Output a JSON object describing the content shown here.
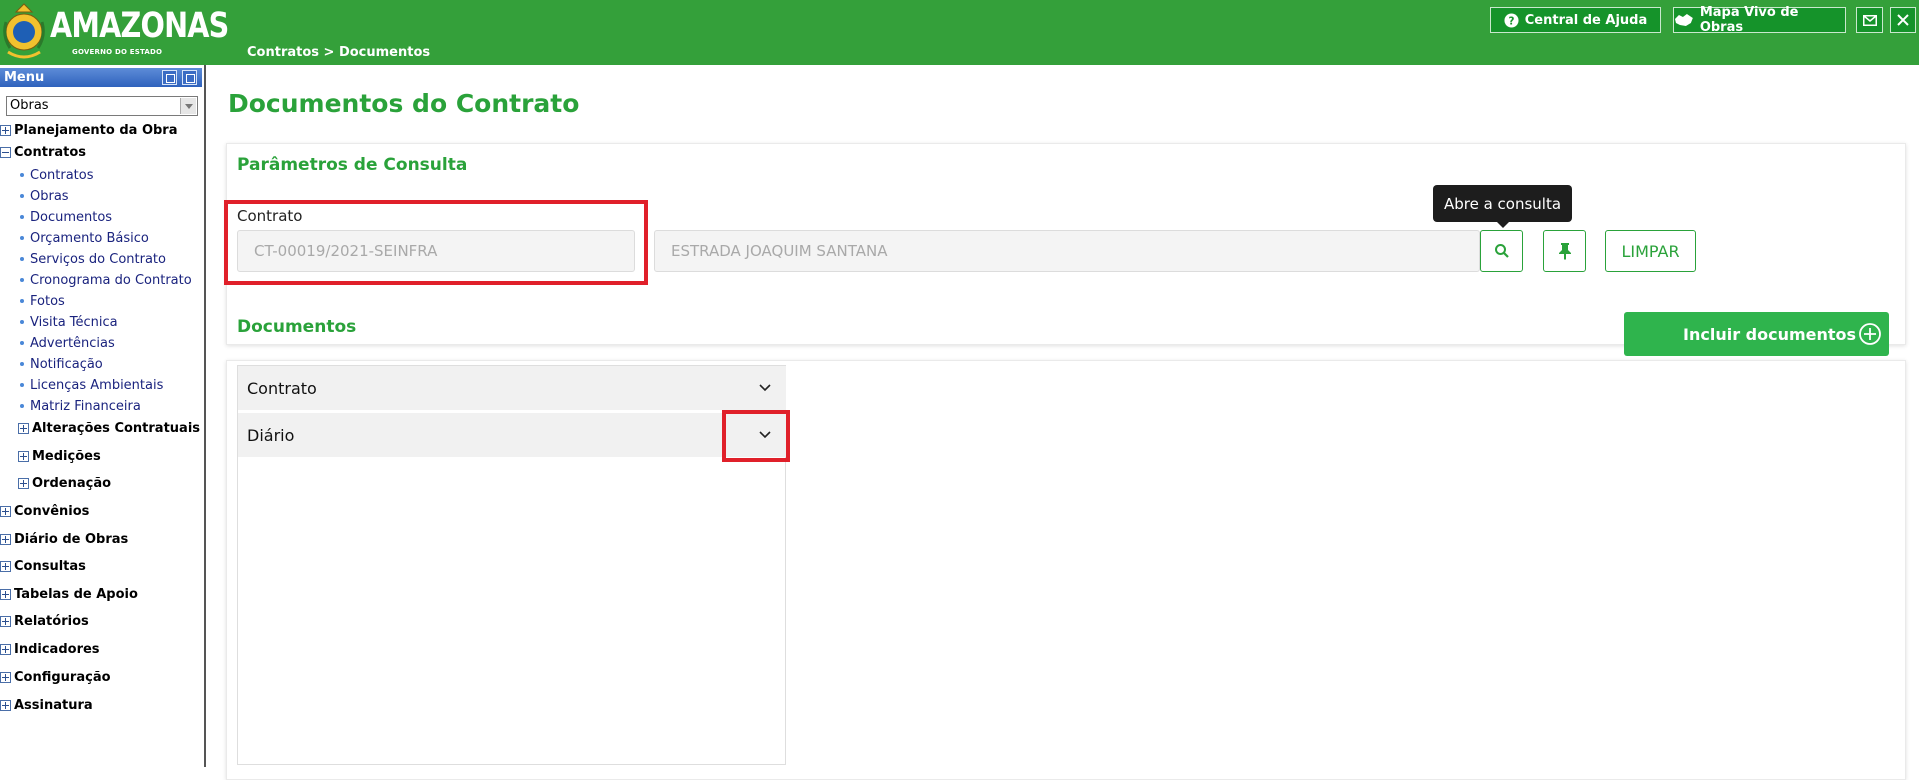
{
  "header": {
    "logo_title": "AMAZONAS",
    "logo_subtitle": "GOVERNO DO ESTADO",
    "breadcrumb": "Contratos > Documentos",
    "help_label": "Central de Ajuda",
    "map_label": "Mapa Vivo de Obras",
    "mail_icon": "mail-icon",
    "close_icon": "close-icon"
  },
  "sidebar": {
    "menu_label": "Menu",
    "select_value": "Obras",
    "tree": [
      {
        "label": "Planejamento da Obra",
        "expanded": false
      },
      {
        "label": "Contratos",
        "expanded": true
      }
    ],
    "contratos_children": [
      "Contratos",
      "Obras",
      "Documentos",
      "Orçamento Básico",
      "Serviços do Contrato",
      "Cronograma do Contrato",
      "Fotos",
      "Visita Técnica",
      "Advertências",
      "Notificação",
      "Licenças Ambientais",
      "Matriz Financeira"
    ],
    "contratos_groups": [
      "Alterações Contratuais",
      "Medições",
      "Ordenação"
    ],
    "more_tree": [
      "Convênios",
      "Diário de Obras",
      "Consultas",
      "Tabelas de Apoio",
      "Relatórios",
      "Indicadores",
      "Configuração",
      "Assinatura"
    ]
  },
  "main": {
    "page_title": "Documentos do Contrato",
    "params_title": "Parâmetros de Consulta",
    "contrato_label": "Contrato",
    "contrato_code": "CT-00019/2021-SEINFRA",
    "contrato_desc": "ESTRADA JOAQUIM SANTANA",
    "tooltip": "Abre a consulta",
    "clear_label": "LIMPAR",
    "docs_title": "Documentos",
    "add_docs_label": "Incluir documentos",
    "accordion": [
      "Contrato",
      "Diário"
    ]
  },
  "colors": {
    "header_green": "#34a03a",
    "accent_green": "#2aa23a",
    "highlight_red": "#e0202a"
  }
}
